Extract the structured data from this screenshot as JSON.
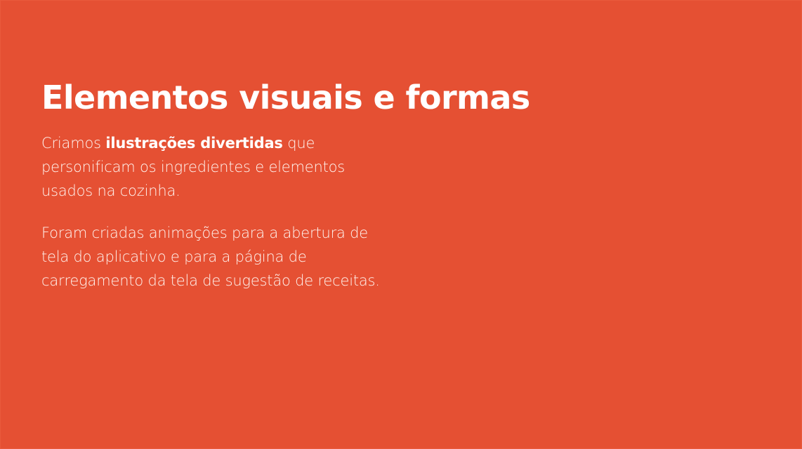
{
  "slide": {
    "background_color": "#e55033",
    "text_color": "#ffffff",
    "title": "Elementos visuais e formas",
    "paragraph1": {
      "line1_before": "Criamos ",
      "line1_bold": "ilustrações divertidas",
      "line1_after": " que",
      "line2": "personificam os ingredientes e elementos",
      "line3": "usados na cozinha."
    },
    "paragraph2": {
      "line1": "Foram criadas animações para a abertura de",
      "line2": "tela do aplicativo e para a página de",
      "line3": "carregamento da tela de sugestão de receitas."
    }
  }
}
